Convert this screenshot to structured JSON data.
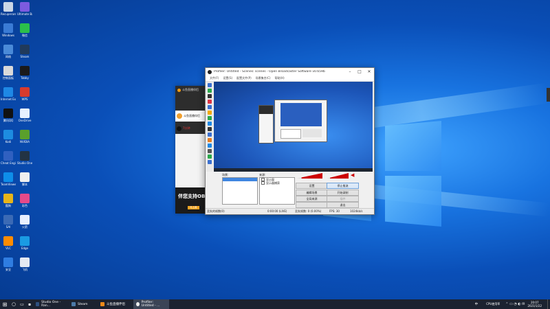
{
  "desktop": {
    "icons": [
      {
        "label": "Recuperare",
        "icon": "recycle-bin-icon",
        "color": "#c9d6e6"
      },
      {
        "label": "Ultimate Ball",
        "icon": "app-icon",
        "color": "#7d5be0"
      },
      {
        "label": "Windows",
        "icon": "folder-icon",
        "color": "#3a7bd5"
      },
      {
        "label": "微信",
        "icon": "wechat-icon",
        "color": "#2bbf4b"
      },
      {
        "label": "网络",
        "icon": "network-icon",
        "color": "#4a8ad8"
      },
      {
        "label": "Steam",
        "icon": "steam-icon",
        "color": "#203a5c"
      },
      {
        "label": "控制面板",
        "icon": "control-panel-icon",
        "color": "#d9d9d9"
      },
      {
        "label": "Tabby",
        "icon": "terminal-icon",
        "color": "#1a1a1a"
      },
      {
        "label": "Internet Explorer",
        "icon": "ie-icon",
        "color": "#1e88e5"
      },
      {
        "label": "WPS",
        "icon": "wps-icon",
        "color": "#d83b2e"
      },
      {
        "label": "腾讯QQ",
        "icon": "qq-icon",
        "color": "#111111"
      },
      {
        "label": "OneDrive",
        "icon": "cloud-icon",
        "color": "#e6f1ff"
      },
      {
        "label": "Kodi",
        "icon": "kodi-icon",
        "color": "#1d8ce0"
      },
      {
        "label": "NVIDIA",
        "icon": "nvidia-icon",
        "color": "#5aa02c"
      },
      {
        "label": "Cheat Engine",
        "icon": "gear-icon",
        "color": "#3060c0"
      },
      {
        "label": "Studio One",
        "icon": "studio-icon",
        "color": "#223344"
      },
      {
        "label": "TeamViewer",
        "icon": "teamviewer-icon",
        "color": "#0e8ee9"
      },
      {
        "label": "脚本",
        "icon": "script-icon",
        "color": "#f0f0f0"
      },
      {
        "label": "酷狗",
        "icon": "owl-icon",
        "color": "#e7b41a"
      },
      {
        "label": "彩色",
        "icon": "color-icon",
        "color": "#e64a8a"
      },
      {
        "label": "SAI",
        "icon": "sai-icon",
        "color": "#3b6ab5"
      },
      {
        "label": "火箭",
        "icon": "plane-icon",
        "color": "#e8f0ff"
      },
      {
        "label": "VLC",
        "icon": "cone-icon",
        "color": "#ff8c00"
      },
      {
        "label": "Edge",
        "icon": "edge-icon",
        "color": "#1a9be3"
      },
      {
        "label": "安全",
        "icon": "shield-icon",
        "color": "#2f7de1"
      },
      {
        "label": "飞机",
        "icon": "airplane-icon",
        "color": "#e5eaf2"
      }
    ]
  },
  "kuaishou": {
    "title": "斗鱼直播伴侣",
    "item1": "斗鱼直播伴侣",
    "item2": "7分钟",
    "banner": "伴您支持OB",
    "banner_btn": "马上用"
  },
  "obs": {
    "title": "Profiler: Untitled - Scenes: scenes - Open Broadcaster Software v0.659b",
    "menu": [
      "文件(F)",
      "设置(S)",
      "配置文件(P)",
      "场景集合(C)",
      "帮助(H)"
    ],
    "scenes_label": "场景:",
    "sources_label": "来源:",
    "sources": [
      "显示窗",
      "显示器捕获"
    ],
    "buttons": {
      "settings": "设置",
      "stop_stream": "停止推流",
      "edit_scene": "编辑场景",
      "start_record": "开始录制",
      "global_sources": "全局来源",
      "plugins": "插件",
      "exit": "退出"
    },
    "status": {
      "dropped": "丢失的帧数(0)",
      "time": "0:00:00 (LIVE)",
      "frames": "丢失帧数: 0 (0.00%)",
      "fps": "FPS: 30",
      "kbps": "1024kb/s"
    }
  },
  "taskbar": {
    "apps": [
      {
        "label": "Studio One - Ran...",
        "color": "#2f5080"
      },
      {
        "label": "Steam",
        "color": "#1a3352"
      },
      {
        "label": "斗鱼直播伴侣",
        "color": "#f08a1a"
      },
      {
        "label": "Profiler: Untitled - ...",
        "color": "#202020"
      }
    ],
    "tray": {
      "lang": "中",
      "net": "CPU使用率",
      "time": "20:07",
      "date": "2021/1/22"
    }
  }
}
